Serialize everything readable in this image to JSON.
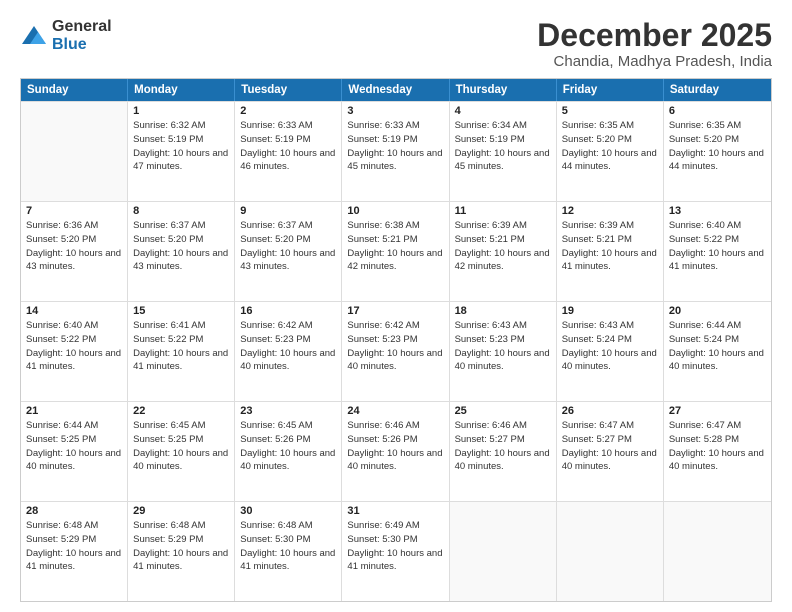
{
  "logo": {
    "general": "General",
    "blue": "Blue"
  },
  "title": "December 2025",
  "subtitle": "Chandia, Madhya Pradesh, India",
  "header_days": [
    "Sunday",
    "Monday",
    "Tuesday",
    "Wednesday",
    "Thursday",
    "Friday",
    "Saturday"
  ],
  "rows": [
    [
      {
        "day": "",
        "sunrise": "",
        "sunset": "",
        "daylight": ""
      },
      {
        "day": "1",
        "sunrise": "Sunrise: 6:32 AM",
        "sunset": "Sunset: 5:19 PM",
        "daylight": "Daylight: 10 hours and 47 minutes."
      },
      {
        "day": "2",
        "sunrise": "Sunrise: 6:33 AM",
        "sunset": "Sunset: 5:19 PM",
        "daylight": "Daylight: 10 hours and 46 minutes."
      },
      {
        "day": "3",
        "sunrise": "Sunrise: 6:33 AM",
        "sunset": "Sunset: 5:19 PM",
        "daylight": "Daylight: 10 hours and 45 minutes."
      },
      {
        "day": "4",
        "sunrise": "Sunrise: 6:34 AM",
        "sunset": "Sunset: 5:19 PM",
        "daylight": "Daylight: 10 hours and 45 minutes."
      },
      {
        "day": "5",
        "sunrise": "Sunrise: 6:35 AM",
        "sunset": "Sunset: 5:20 PM",
        "daylight": "Daylight: 10 hours and 44 minutes."
      },
      {
        "day": "6",
        "sunrise": "Sunrise: 6:35 AM",
        "sunset": "Sunset: 5:20 PM",
        "daylight": "Daylight: 10 hours and 44 minutes."
      }
    ],
    [
      {
        "day": "7",
        "sunrise": "Sunrise: 6:36 AM",
        "sunset": "Sunset: 5:20 PM",
        "daylight": "Daylight: 10 hours and 43 minutes."
      },
      {
        "day": "8",
        "sunrise": "Sunrise: 6:37 AM",
        "sunset": "Sunset: 5:20 PM",
        "daylight": "Daylight: 10 hours and 43 minutes."
      },
      {
        "day": "9",
        "sunrise": "Sunrise: 6:37 AM",
        "sunset": "Sunset: 5:20 PM",
        "daylight": "Daylight: 10 hours and 43 minutes."
      },
      {
        "day": "10",
        "sunrise": "Sunrise: 6:38 AM",
        "sunset": "Sunset: 5:21 PM",
        "daylight": "Daylight: 10 hours and 42 minutes."
      },
      {
        "day": "11",
        "sunrise": "Sunrise: 6:39 AM",
        "sunset": "Sunset: 5:21 PM",
        "daylight": "Daylight: 10 hours and 42 minutes."
      },
      {
        "day": "12",
        "sunrise": "Sunrise: 6:39 AM",
        "sunset": "Sunset: 5:21 PM",
        "daylight": "Daylight: 10 hours and 41 minutes."
      },
      {
        "day": "13",
        "sunrise": "Sunrise: 6:40 AM",
        "sunset": "Sunset: 5:22 PM",
        "daylight": "Daylight: 10 hours and 41 minutes."
      }
    ],
    [
      {
        "day": "14",
        "sunrise": "Sunrise: 6:40 AM",
        "sunset": "Sunset: 5:22 PM",
        "daylight": "Daylight: 10 hours and 41 minutes."
      },
      {
        "day": "15",
        "sunrise": "Sunrise: 6:41 AM",
        "sunset": "Sunset: 5:22 PM",
        "daylight": "Daylight: 10 hours and 41 minutes."
      },
      {
        "day": "16",
        "sunrise": "Sunrise: 6:42 AM",
        "sunset": "Sunset: 5:23 PM",
        "daylight": "Daylight: 10 hours and 40 minutes."
      },
      {
        "day": "17",
        "sunrise": "Sunrise: 6:42 AM",
        "sunset": "Sunset: 5:23 PM",
        "daylight": "Daylight: 10 hours and 40 minutes."
      },
      {
        "day": "18",
        "sunrise": "Sunrise: 6:43 AM",
        "sunset": "Sunset: 5:23 PM",
        "daylight": "Daylight: 10 hours and 40 minutes."
      },
      {
        "day": "19",
        "sunrise": "Sunrise: 6:43 AM",
        "sunset": "Sunset: 5:24 PM",
        "daylight": "Daylight: 10 hours and 40 minutes."
      },
      {
        "day": "20",
        "sunrise": "Sunrise: 6:44 AM",
        "sunset": "Sunset: 5:24 PM",
        "daylight": "Daylight: 10 hours and 40 minutes."
      }
    ],
    [
      {
        "day": "21",
        "sunrise": "Sunrise: 6:44 AM",
        "sunset": "Sunset: 5:25 PM",
        "daylight": "Daylight: 10 hours and 40 minutes."
      },
      {
        "day": "22",
        "sunrise": "Sunrise: 6:45 AM",
        "sunset": "Sunset: 5:25 PM",
        "daylight": "Daylight: 10 hours and 40 minutes."
      },
      {
        "day": "23",
        "sunrise": "Sunrise: 6:45 AM",
        "sunset": "Sunset: 5:26 PM",
        "daylight": "Daylight: 10 hours and 40 minutes."
      },
      {
        "day": "24",
        "sunrise": "Sunrise: 6:46 AM",
        "sunset": "Sunset: 5:26 PM",
        "daylight": "Daylight: 10 hours and 40 minutes."
      },
      {
        "day": "25",
        "sunrise": "Sunrise: 6:46 AM",
        "sunset": "Sunset: 5:27 PM",
        "daylight": "Daylight: 10 hours and 40 minutes."
      },
      {
        "day": "26",
        "sunrise": "Sunrise: 6:47 AM",
        "sunset": "Sunset: 5:27 PM",
        "daylight": "Daylight: 10 hours and 40 minutes."
      },
      {
        "day": "27",
        "sunrise": "Sunrise: 6:47 AM",
        "sunset": "Sunset: 5:28 PM",
        "daylight": "Daylight: 10 hours and 40 minutes."
      }
    ],
    [
      {
        "day": "28",
        "sunrise": "Sunrise: 6:48 AM",
        "sunset": "Sunset: 5:29 PM",
        "daylight": "Daylight: 10 hours and 41 minutes."
      },
      {
        "day": "29",
        "sunrise": "Sunrise: 6:48 AM",
        "sunset": "Sunset: 5:29 PM",
        "daylight": "Daylight: 10 hours and 41 minutes."
      },
      {
        "day": "30",
        "sunrise": "Sunrise: 6:48 AM",
        "sunset": "Sunset: 5:30 PM",
        "daylight": "Daylight: 10 hours and 41 minutes."
      },
      {
        "day": "31",
        "sunrise": "Sunrise: 6:49 AM",
        "sunset": "Sunset: 5:30 PM",
        "daylight": "Daylight: 10 hours and 41 minutes."
      },
      {
        "day": "",
        "sunrise": "",
        "sunset": "",
        "daylight": ""
      },
      {
        "day": "",
        "sunrise": "",
        "sunset": "",
        "daylight": ""
      },
      {
        "day": "",
        "sunrise": "",
        "sunset": "",
        "daylight": ""
      }
    ]
  ]
}
